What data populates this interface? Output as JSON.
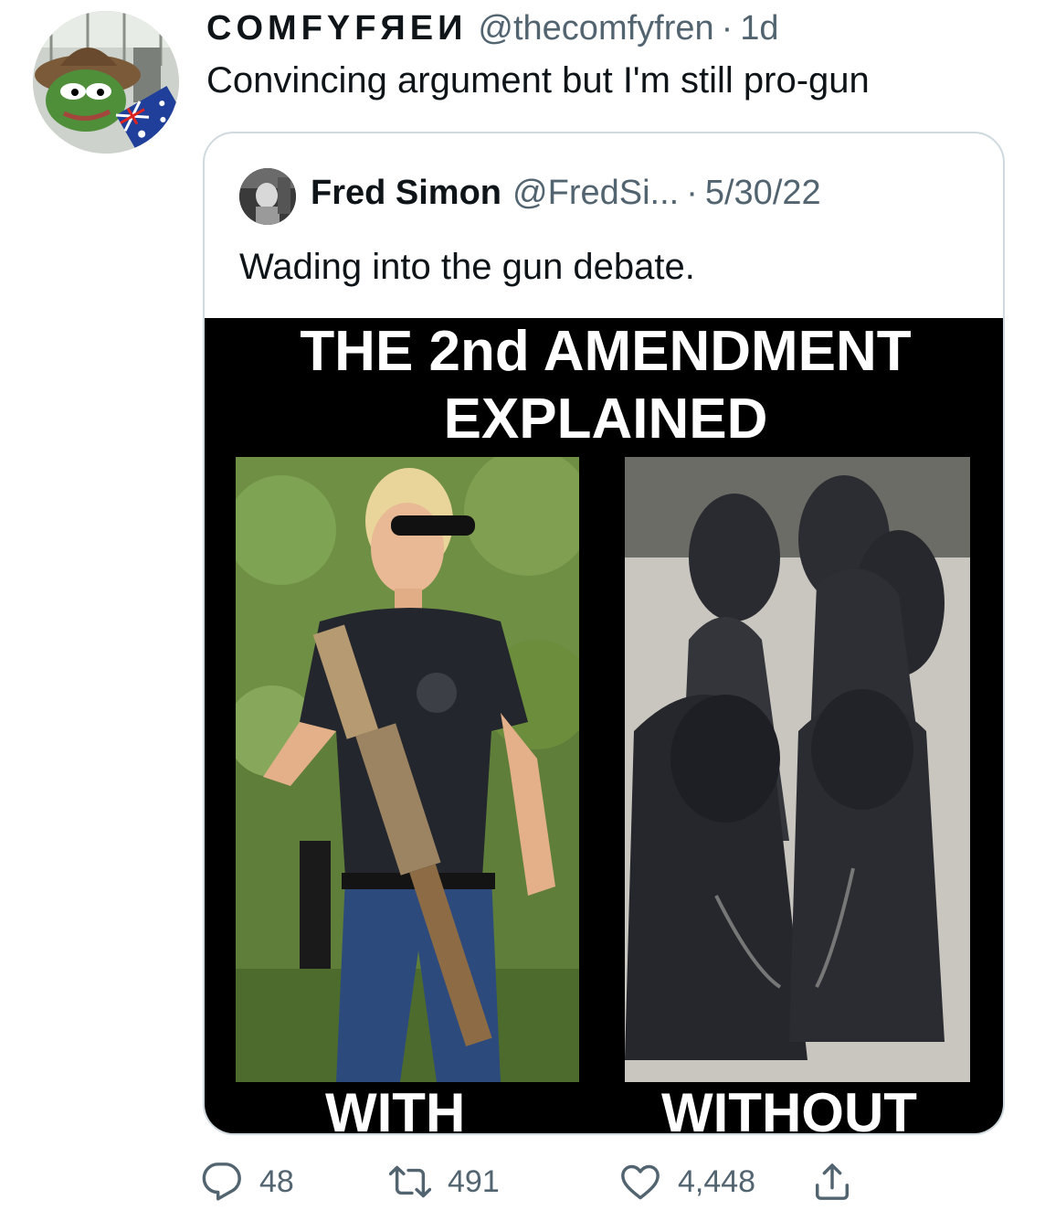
{
  "tweet": {
    "display_name": "COMFYFЯEИ",
    "handle": "@thecomfyfren",
    "separator": "·",
    "time": "1d",
    "text": "Convincing argument but I'm still pro-gun"
  },
  "quote": {
    "display_name": "Fred Simon",
    "handle": "@FredSi...",
    "separator": "·",
    "date": "5/30/22",
    "text": "Wading into the gun debate.",
    "meme": {
      "title_line_1": "THE 2nd AMENDMENT",
      "title_line_2": "EXPLAINED",
      "caption_left": "WITH",
      "caption_right": "WITHOUT"
    }
  },
  "actions": {
    "reply_count": "48",
    "retweet_count": "491",
    "like_count": "4,448",
    "icons": [
      "reply-icon",
      "retweet-icon",
      "like-icon",
      "share-icon"
    ]
  },
  "colors": {
    "text_primary": "#0f1419",
    "text_secondary": "#536471",
    "border": "#cfd9de",
    "meme_background": "#000000"
  }
}
